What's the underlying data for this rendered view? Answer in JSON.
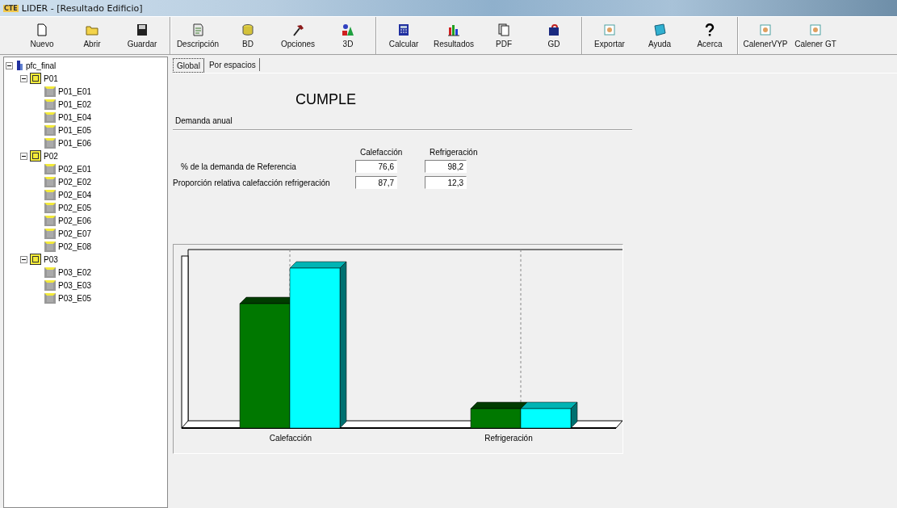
{
  "window": {
    "title": "LIDER - [Resultado Edificio]",
    "app_badge": "CTE"
  },
  "toolbar": [
    [
      {
        "label": "Nuevo",
        "kind": "new"
      },
      {
        "label": "Abrir",
        "kind": "open"
      },
      {
        "label": "Guardar",
        "kind": "save"
      }
    ],
    [
      {
        "label": "Descripción",
        "kind": "describe"
      },
      {
        "label": "BD",
        "kind": "db"
      },
      {
        "label": "Opciones",
        "kind": "hammer"
      },
      {
        "label": "3D",
        "kind": "shapes"
      }
    ],
    [
      {
        "label": "Calcular",
        "kind": "calc"
      },
      {
        "label": "Resultados",
        "kind": "bars"
      },
      {
        "label": "PDF",
        "kind": "pages"
      },
      {
        "label": "GD",
        "kind": "disk"
      }
    ],
    [
      {
        "label": "Exportar",
        "kind": "export"
      },
      {
        "label": "Ayuda",
        "kind": "help"
      },
      {
        "label": "Acerca",
        "kind": "question"
      }
    ],
    [
      {
        "label": "CalenerVYP",
        "kind": "export"
      },
      {
        "label": "Calener GT",
        "kind": "export"
      }
    ]
  ],
  "tree": {
    "label": "pfc_final",
    "expanded": true,
    "children": [
      {
        "label": "P01",
        "expanded": true,
        "children": [
          {
            "label": "P01_E01"
          },
          {
            "label": "P01_E02"
          },
          {
            "label": "P01_E04"
          },
          {
            "label": "P01_E05"
          },
          {
            "label": "P01_E06"
          }
        ]
      },
      {
        "label": "P02",
        "expanded": true,
        "children": [
          {
            "label": "P02_E01"
          },
          {
            "label": "P02_E02"
          },
          {
            "label": "P02_E04"
          },
          {
            "label": "P02_E05"
          },
          {
            "label": "P02_E06"
          },
          {
            "label": "P02_E07"
          },
          {
            "label": "P02_E08"
          }
        ]
      },
      {
        "label": "P03",
        "expanded": true,
        "children": [
          {
            "label": "P03_E02"
          },
          {
            "label": "P03_E03"
          },
          {
            "label": "P03_E05"
          }
        ]
      }
    ]
  },
  "tabs": [
    {
      "label": "Global",
      "selected": true
    },
    {
      "label": "Por espacios",
      "selected": false
    }
  ],
  "result": "CUMPLE",
  "section": "Demanda anual",
  "columns": [
    "Calefacción",
    "Refrigeración"
  ],
  "rows": [
    {
      "label": "% de la demanda de Referencia",
      "values": [
        "76,6",
        "98,2"
      ]
    },
    {
      "label": "Proporción relativa calefacción refrigeración",
      "values": [
        "87,7",
        "12,3"
      ]
    }
  ],
  "chart": {
    "categories": [
      "Calefacción",
      "Refrigeración"
    ]
  }
}
